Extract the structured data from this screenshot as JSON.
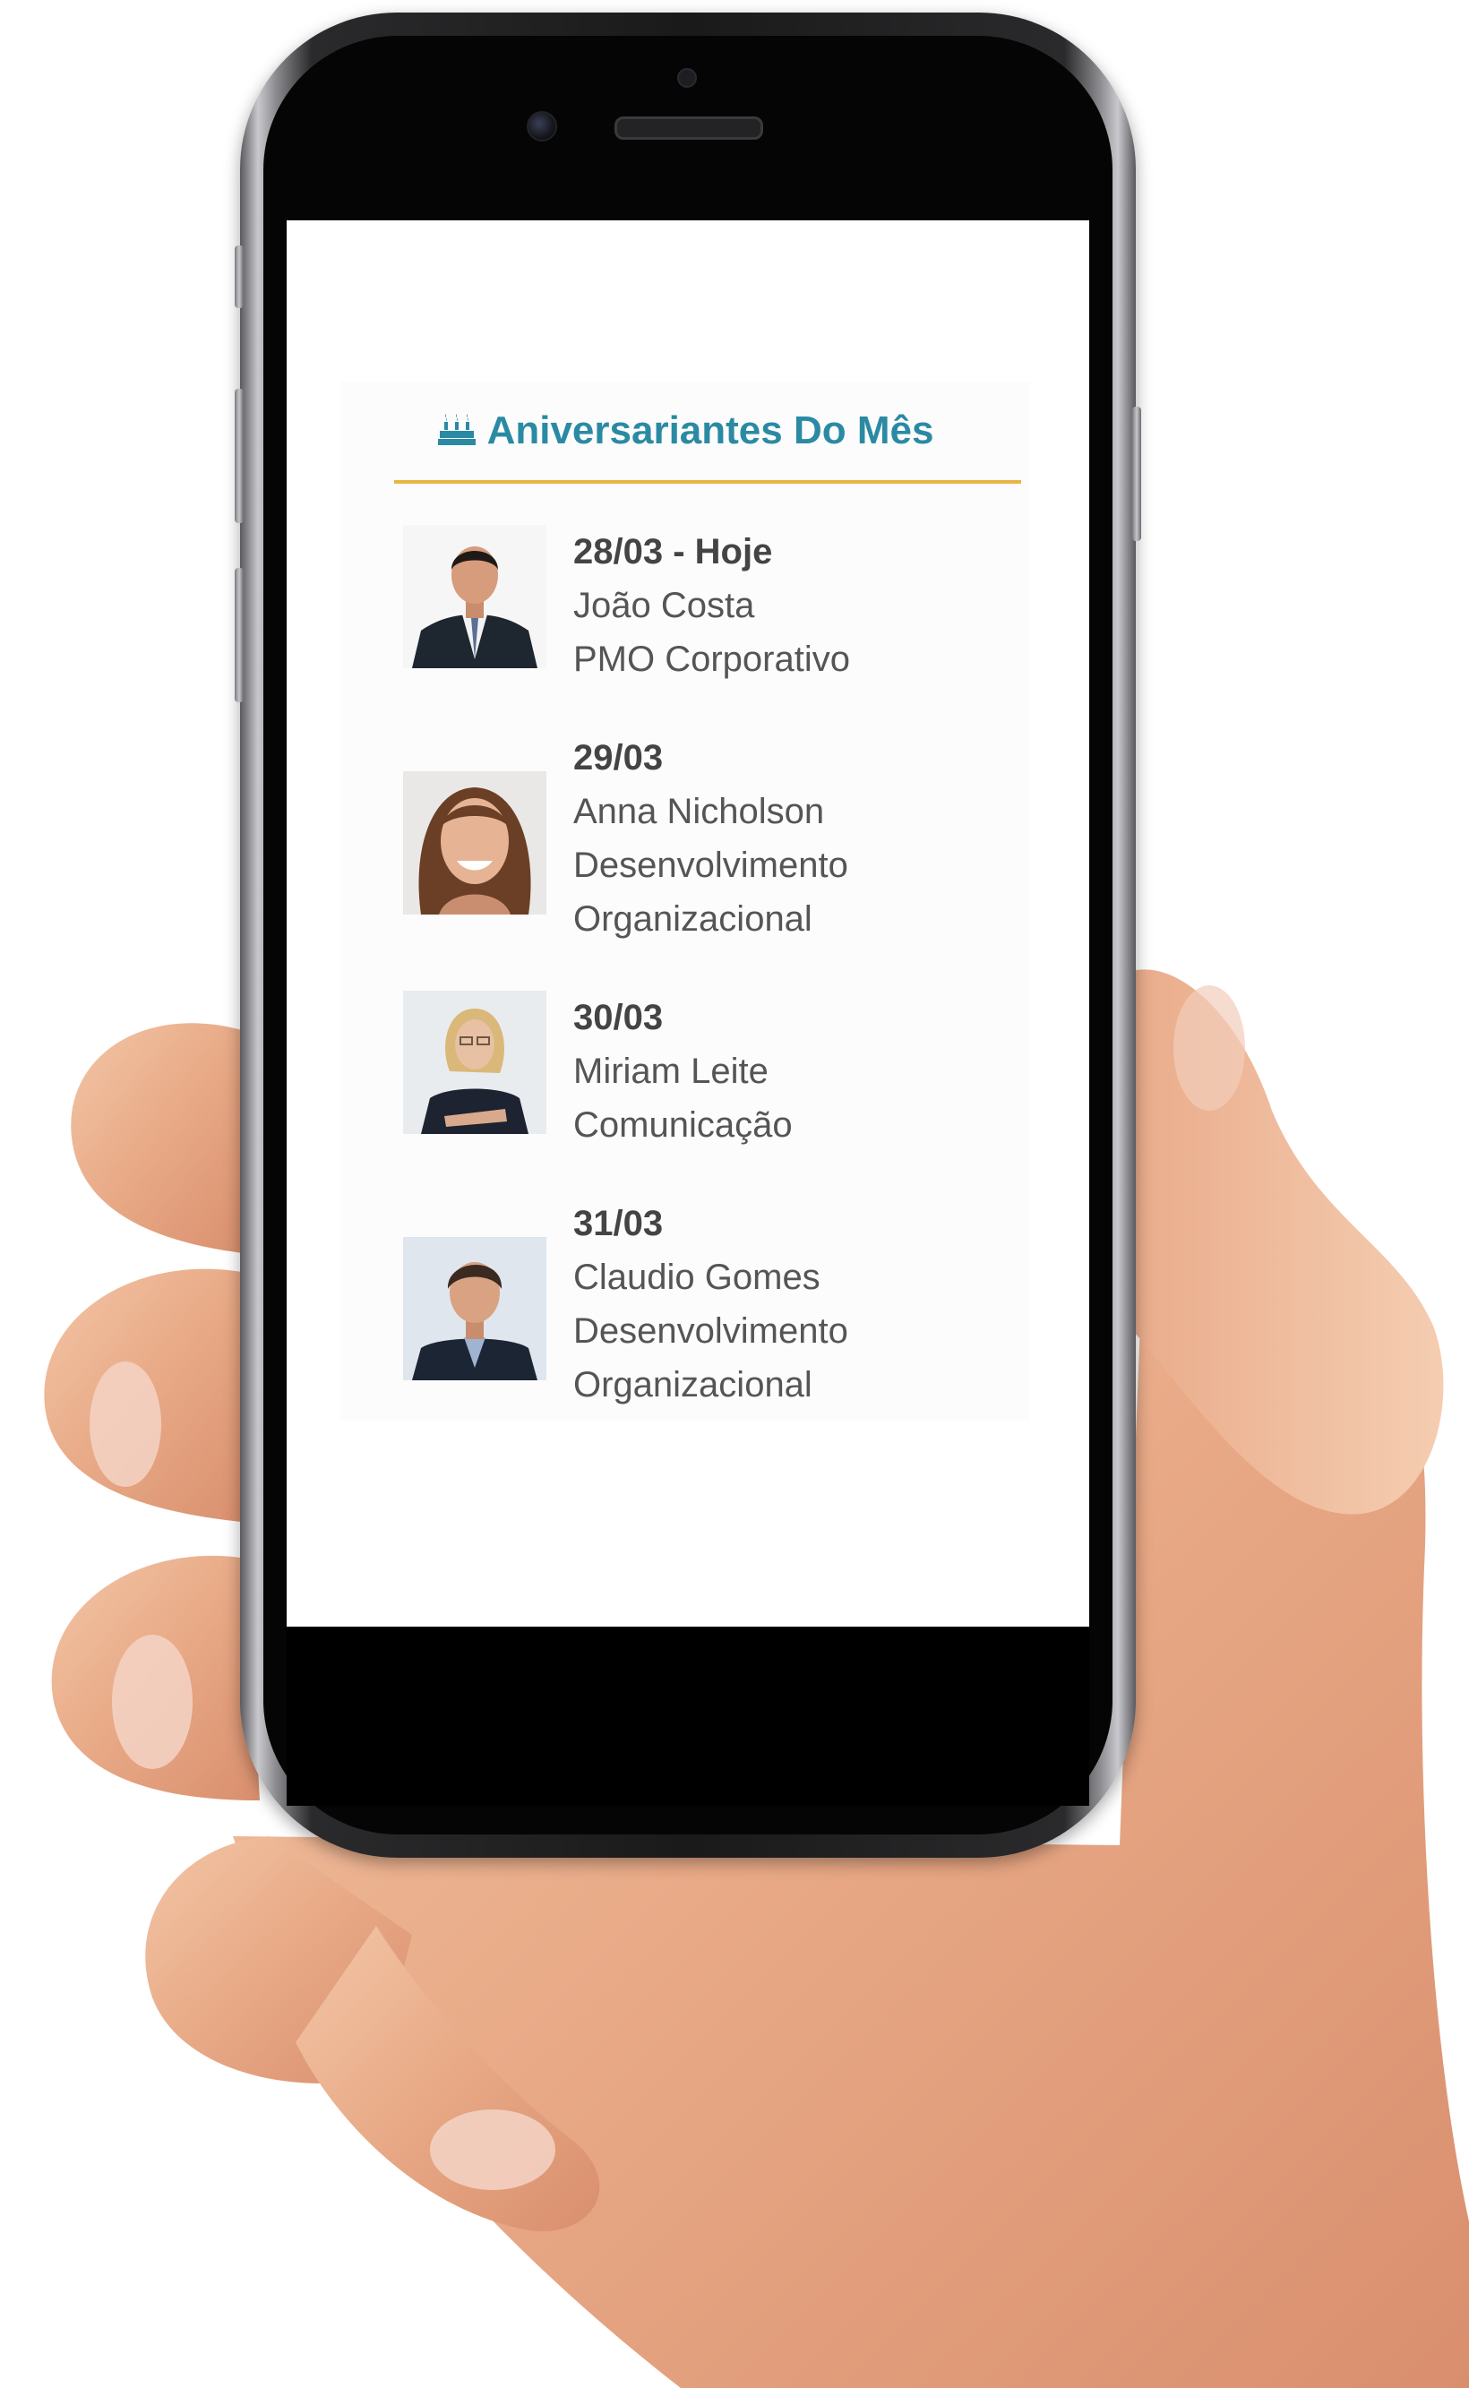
{
  "widget": {
    "title": "Aniversariantes Do Mês",
    "title_icon": "birthday-cake-icon",
    "accent_color": "#2b8aa3",
    "divider_color": "#e8b544"
  },
  "birthdays": [
    {
      "date": "28/03 - Hoje",
      "name": "João Costa",
      "department_line1": "PMO Corporativo",
      "department_line2": ""
    },
    {
      "date": "29/03",
      "name": "Anna Nicholson",
      "department_line1": "Desenvolvimento",
      "department_line2": "Organizacional"
    },
    {
      "date": "30/03",
      "name": "Miriam Leite",
      "department_line1": "Comunicação",
      "department_line2": ""
    },
    {
      "date": "31/03",
      "name": "Claudio Gomes",
      "department_line1": "Desenvolvimento",
      "department_line2": "Organizacional"
    }
  ]
}
